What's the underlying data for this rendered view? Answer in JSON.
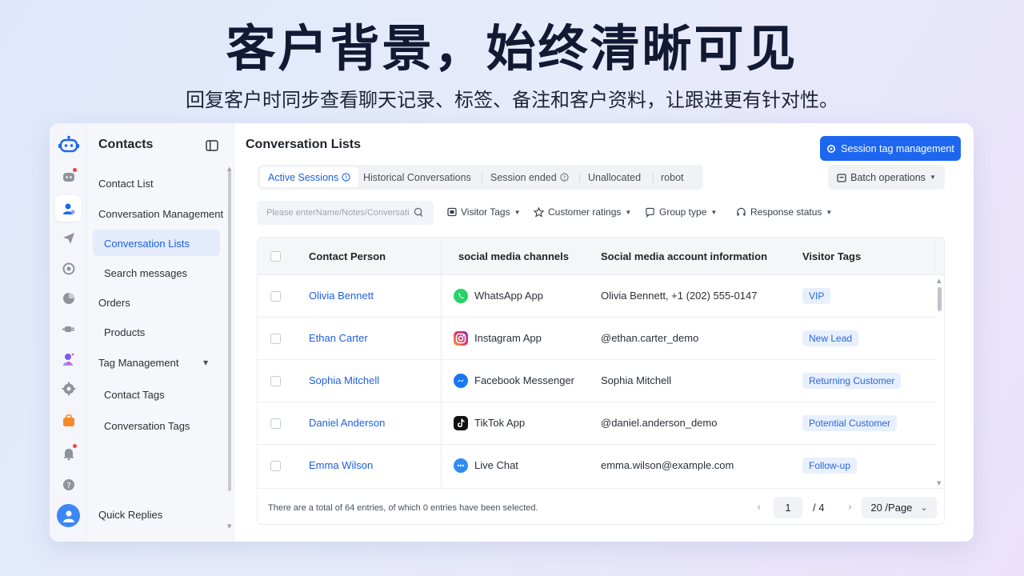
{
  "hero": {
    "title": "客户背景，始终清晰可见",
    "subtitle": "回复客户时同步查看聊天记录、标签、备注和客户资料，让跟进更有针对性。"
  },
  "sidebar": {
    "title": "Contacts",
    "items": [
      {
        "label": "Contact List"
      },
      {
        "label": "Conversation Management"
      },
      {
        "label": "Conversation Lists"
      },
      {
        "label": "Search messages"
      },
      {
        "label": "Orders"
      },
      {
        "label": "Products"
      },
      {
        "label": "Tag Management"
      },
      {
        "label": "Contact Tags"
      },
      {
        "label": "Conversation Tags"
      },
      {
        "label": "Quick Replies"
      }
    ]
  },
  "main": {
    "title": "Conversation Lists",
    "primary_button": "Session tag management",
    "tabs": [
      {
        "label": "Active Sessions"
      },
      {
        "label": "Historical Conversations"
      },
      {
        "label": "Session ended"
      },
      {
        "label": "Unallocated"
      },
      {
        "label": "robot"
      }
    ],
    "batch_button": "Batch operations",
    "search_placeholder": "Please enterName/Notes/Conversation",
    "filters": [
      {
        "label": "Visitor Tags"
      },
      {
        "label": "Customer ratings"
      },
      {
        "label": "Group type"
      },
      {
        "label": "Response status"
      }
    ]
  },
  "table": {
    "columns": [
      "Contact Person",
      "social media channels",
      "Social media account information",
      "Visitor Tags"
    ],
    "rows": [
      {
        "name": "Olivia Bennett",
        "channel": "WhatsApp App",
        "account": "Olivia Bennett, +1 (202) 555-0147",
        "tag": "VIP"
      },
      {
        "name": "Ethan Carter",
        "channel": "Instagram App",
        "account": "@ethan.carter_demo",
        "tag": "New Lead"
      },
      {
        "name": "Sophia Mitchell",
        "channel": "Facebook Messenger",
        "account": "Sophia Mitchell",
        "tag": "Returning Customer"
      },
      {
        "name": "Daniel Anderson",
        "channel": "TikTok App",
        "account": "@daniel.anderson_demo",
        "tag": "Potential Customer"
      },
      {
        "name": "Emma Wilson",
        "channel": "Live Chat",
        "account": "emma.wilson@example.com",
        "tag": "Follow-up"
      }
    ]
  },
  "footer": {
    "summary": "There are a total of 64 entries, of which 0 entries have been selected.",
    "page": "1",
    "total_pages": "/  4",
    "page_size": "20 /Page"
  },
  "colors": {
    "accent": "#1d66f0",
    "tag_bg": "#e8f0fd",
    "whatsapp": "#25d366",
    "messenger": "#1877f2"
  }
}
